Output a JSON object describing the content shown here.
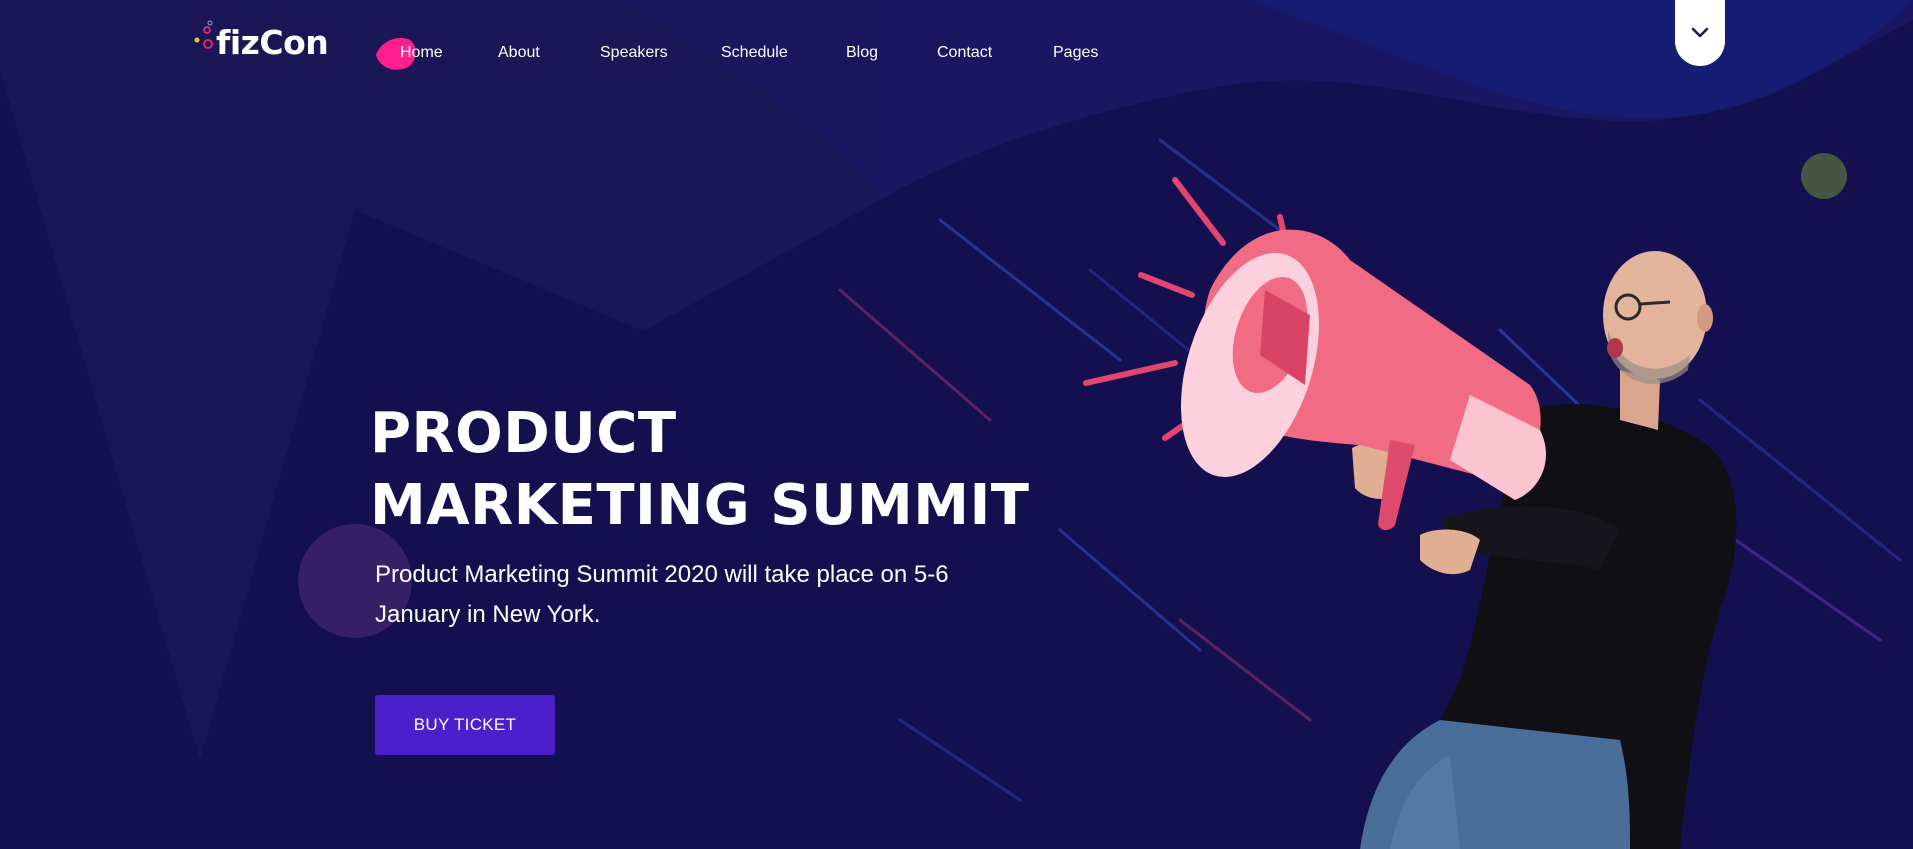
{
  "brand": {
    "name": "fizCon"
  },
  "nav": {
    "items": [
      {
        "label": "Home",
        "active": true
      },
      {
        "label": "About"
      },
      {
        "label": "Speakers"
      },
      {
        "label": "Schedule"
      },
      {
        "label": "Blog"
      },
      {
        "label": "Contact"
      },
      {
        "label": "Pages"
      }
    ]
  },
  "hero": {
    "title_line1": "PRODUCT",
    "title_line2": "MARKETING SUMMIT",
    "description": "Product Marketing Summit 2020 will take place on 5-6 January in New York.",
    "cta_label": "BUY TICKET"
  },
  "icons": {
    "scroll_toggle": "chevron-down-icon",
    "megaphone": "megaphone-illustration"
  },
  "colors": {
    "background": "#140f4f",
    "accent": "#4b1fc9",
    "nav_active": "#ff1f8e",
    "megaphone": "#f06b83"
  }
}
